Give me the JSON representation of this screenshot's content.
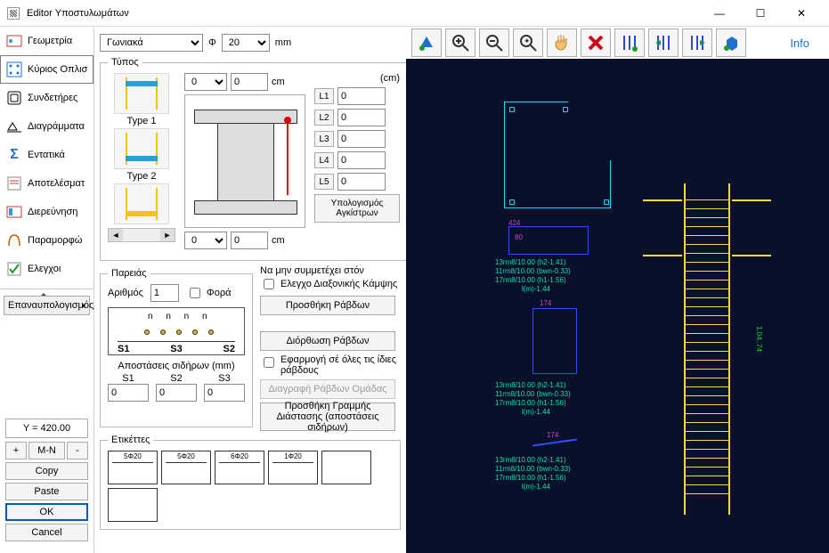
{
  "window": {
    "title": "Editor Υποστυλωμάτων"
  },
  "winbtns": {
    "min": "—",
    "max": "☐",
    "close": "✕"
  },
  "sidebar": {
    "items": [
      {
        "label": "Γεωμετρία",
        "icon": "geometry"
      },
      {
        "label": "Κύριος Οπλισ",
        "icon": "rebar"
      },
      {
        "label": "Συνδετήρες",
        "icon": "stirrups"
      },
      {
        "label": "Διαγράμματα",
        "icon": "diagrams"
      },
      {
        "label": "Εντατικά",
        "icon": "forces"
      },
      {
        "label": "Αποτελέσματ",
        "icon": "results"
      },
      {
        "label": "Διερεύνηση",
        "icon": "explore"
      },
      {
        "label": "Παραμορφώ",
        "icon": "deform"
      },
      {
        "label": "Ελεγχοι",
        "icon": "checks"
      }
    ]
  },
  "recalc": "Επαναυπολογισμός",
  "y_readout": "Y = 420.00",
  "btns": {
    "plus": "+",
    "mn": "M-N",
    "minus": "-",
    "copy": "Copy",
    "paste": "Paste",
    "ok": "OK",
    "cancel": "Cancel"
  },
  "bar_selector": {
    "kind": "Γωνιακά",
    "phi_label": "Φ",
    "phi": "20",
    "unit": "mm"
  },
  "typos": {
    "legend": "Τύπος",
    "types": [
      "Type 1",
      "Type 2"
    ],
    "cm1": {
      "a": "0",
      "b": "0",
      "u": "cm"
    },
    "cm2": {
      "a": "0",
      "b": "0",
      "u": "cm"
    },
    "cm_header": "(cm)",
    "L": [
      {
        "lbl": "L1",
        "v": "0"
      },
      {
        "lbl": "L2",
        "v": "0"
      },
      {
        "lbl": "L3",
        "v": "0"
      },
      {
        "lbl": "L4",
        "v": "0"
      },
      {
        "lbl": "L5",
        "v": "0"
      }
    ],
    "anch": "Υπολογισμός Αγκίστρων"
  },
  "pareias": {
    "legend": "Παρειάς",
    "num_label": "Αριθμός",
    "num": "1",
    "fora": "Φορά",
    "n_label": "n   n   n   n",
    "s_labels": [
      "S1",
      "S3",
      "S2"
    ],
    "spacing_title": "Αποστάσεις σιδήρων (mm)",
    "cols": [
      "S1",
      "S2",
      "S3"
    ],
    "vals": [
      "0",
      "0",
      "0"
    ]
  },
  "right_actions": {
    "skip_biaxial_title": "Να μην συμμετέχει στόν",
    "skip_biaxial": "Ελεγχο Διαξονικής Κάμψης",
    "add": "Προσθήκη Ράβδων",
    "fix": "Διόρθωση Ράβδων",
    "apply_same": "Εφαρμογή σέ όλες τις ίδιες ράβδους",
    "delgrp": "Διαγραφή Ράβδων Ομάδας",
    "add_dim": "Προσθήκη Γραμμής Διάστασης (αποστάσεις σιδήρων)"
  },
  "etik": {
    "legend": "Ετικέττες",
    "labels": [
      "5Φ20",
      "5Φ20",
      "6Φ20",
      "1Φ20",
      "",
      ""
    ]
  },
  "toolbar": {
    "info": "Info",
    "tips": [
      "3d",
      "zoom-in",
      "zoom-out",
      "zoom-extents",
      "pan",
      "delete",
      "bars-1",
      "bars-2",
      "bars-3",
      "cube"
    ]
  },
  "chart_data": {
    "type": "diagram",
    "notes": "CAD-style column elevation + section preview",
    "column_height_label": "1.04..74",
    "section_dims": {
      "w1": "424",
      "h1": "174",
      "h2": "80"
    },
    "annot": [
      "13rm8/10.00 (h2-1.41)",
      "11rm8/10.00 (bwn-0.33)",
      "17rm8/10.00 (h1-1.56)",
      "l(m)-1.44",
      "13rm8/10.00 (h2-1.41)",
      "11rm8/10.00 (bwn-0.33)",
      "17rm8/10.00 (h1-1.56)",
      "l(m)-1.44",
      "13rm8/10.00 (h2-1.41)",
      "11rm8/10.00 (bwn-0.33)",
      "17rm8/10.00 (h1-1.56)",
      "l(m)-1.44"
    ],
    "magenta_dims": [
      "424",
      "174",
      "174",
      "80"
    ]
  }
}
